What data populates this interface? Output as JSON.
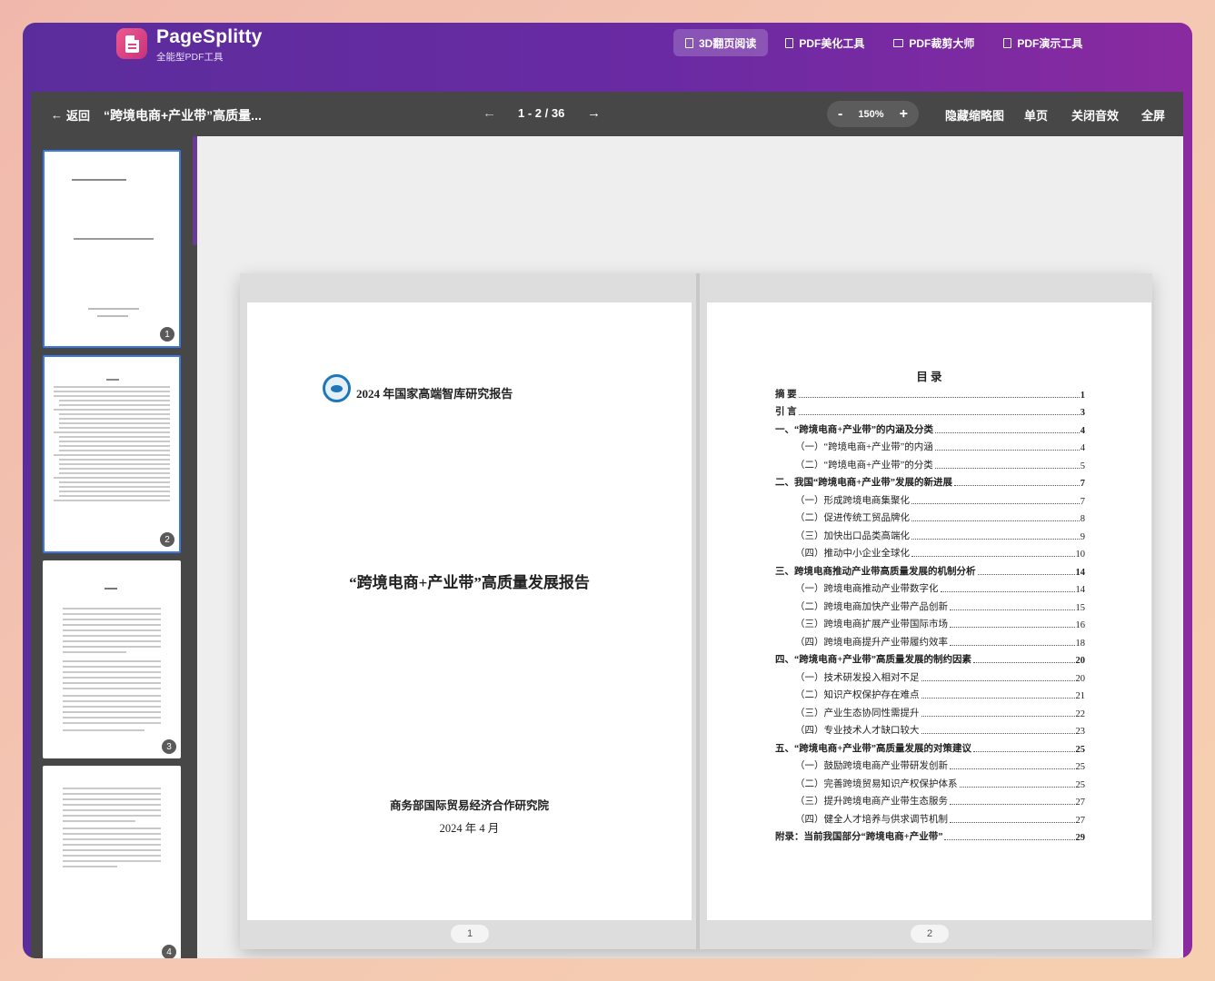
{
  "app": {
    "brand_name": "PageSplitty",
    "brand_sub": "全能型PDF工具",
    "nav": [
      {
        "label": "3D翻页阅读",
        "icon": "book-icon",
        "active": true
      },
      {
        "label": "PDF美化工具",
        "icon": "file-icon",
        "active": false
      },
      {
        "label": "PDF裁剪大师",
        "icon": "crop-icon",
        "active": false
      },
      {
        "label": "PDF演示工具",
        "icon": "file-icon",
        "active": false
      }
    ]
  },
  "toolbar": {
    "back_label": "返回",
    "doc_title": "“跨境电商+产业带”高质量...",
    "page_indicator": "1 - 2 / 36",
    "zoom": "150%",
    "hide_thumbs": "隐藏缩略图",
    "single_page": "单页",
    "sound": "关闭音效",
    "fullscreen": "全屏"
  },
  "thumbnails": [
    {
      "num": "1",
      "active": true
    },
    {
      "num": "2",
      "active": true
    },
    {
      "num": "3",
      "active": false
    },
    {
      "num": "4",
      "active": false
    }
  ],
  "page1": {
    "header": "2024 年国家高端智库研究报告",
    "title": "“跨境电商+产业带”高质量发展报告",
    "institution": "商务部国际贸易经济合作研究院",
    "date": "2024 年 4 月",
    "num": "1"
  },
  "page2": {
    "toc_title": "目  录",
    "num": "2",
    "toc": [
      {
        "label": "摘  要",
        "page": "1",
        "level": 1
      },
      {
        "label": "引  言",
        "page": "3",
        "level": 1
      },
      {
        "label": "一、“跨境电商+产业带”的内涵及分类",
        "page": "4",
        "level": 1
      },
      {
        "label": "（一）“跨境电商+产业带”的内涵",
        "page": "4",
        "level": 2
      },
      {
        "label": "（二）“跨境电商+产业带”的分类",
        "page": "5",
        "level": 2
      },
      {
        "label": "二、我国“跨境电商+产业带”发展的新进展",
        "page": "7",
        "level": 1
      },
      {
        "label": "（一）形成跨境电商集聚化",
        "page": "7",
        "level": 2
      },
      {
        "label": "（二）促进传统工贸品牌化",
        "page": "8",
        "level": 2
      },
      {
        "label": "（三）加快出口品类高端化",
        "page": "9",
        "level": 2
      },
      {
        "label": "（四）推动中小企业全球化",
        "page": "10",
        "level": 2
      },
      {
        "label": "三、跨境电商推动产业带高质量发展的机制分析",
        "page": "14",
        "level": 1
      },
      {
        "label": "（一）跨境电商推动产业带数字化",
        "page": "14",
        "level": 2
      },
      {
        "label": "（二）跨境电商加快产业带产品创新",
        "page": "15",
        "level": 2
      },
      {
        "label": "（三）跨境电商扩展产业带国际市场",
        "page": "16",
        "level": 2
      },
      {
        "label": "（四）跨境电商提升产业带履约效率",
        "page": "18",
        "level": 2
      },
      {
        "label": "四、“跨境电商+产业带”高质量发展的制约因素",
        "page": "20",
        "level": 1
      },
      {
        "label": "（一）技术研发投入相对不足",
        "page": "20",
        "level": 2
      },
      {
        "label": "（二）知识产权保护存在难点",
        "page": "21",
        "level": 2
      },
      {
        "label": "（三）产业生态协同性需提升",
        "page": "22",
        "level": 2
      },
      {
        "label": "（四）专业技术人才缺口较大",
        "page": "23",
        "level": 2
      },
      {
        "label": "五、“跨境电商+产业带”高质量发展的对策建议",
        "page": "25",
        "level": 1
      },
      {
        "label": "（一）鼓励跨境电商产业带研发创新",
        "page": "25",
        "level": 2
      },
      {
        "label": "（二）完善跨境贸易知识产权保护体系",
        "page": "25",
        "level": 2
      },
      {
        "label": "（三）提升跨境电商产业带生态服务",
        "page": "27",
        "level": 2
      },
      {
        "label": "（四）健全人才培养与供求调节机制",
        "page": "27",
        "level": 2
      },
      {
        "label": "附录：当前我国部分“跨境电商+产业带”",
        "page": "29",
        "level": 1
      }
    ]
  }
}
